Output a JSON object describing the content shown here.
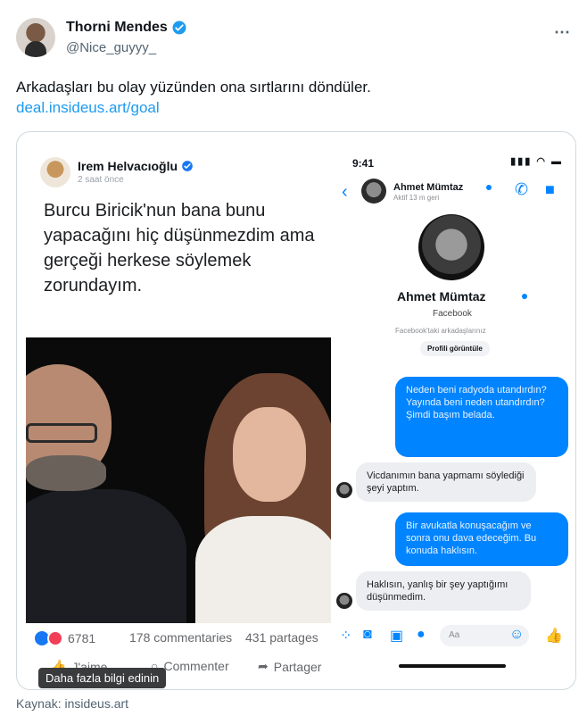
{
  "tweet": {
    "display_name": "Thorni Mendes",
    "handle": "@Nice_guyyy_",
    "more_icon": "⋯",
    "text": "Arkadaşları bu olay yüzünden ona sırtlarını döndüler.",
    "link": "deal.insideus.art/goal"
  },
  "fb_post": {
    "author": "Irem Helvacıoğlu",
    "time": "2 saat önce",
    "quote": "Burcu Biricik'nun bana bunu yapacağını hiç düşünmezdim ama gerçeği herkese söylemek zorundayım.",
    "reaction_count": "6781",
    "comments": "178 commentaries",
    "shares": "431 partages",
    "actions": {
      "like": "J'aime",
      "comment": "Commenter",
      "share": "Partager"
    },
    "tooltip": "Daha fazla bilgi edinin"
  },
  "messenger": {
    "time": "9:41",
    "status_icons": "▮▮▮ ◠ ▬",
    "contact": "Ahmet Mümtaz",
    "active": "Aktif 13 m geri",
    "network": "Facebook",
    "friends_note": "Facebook'taki arkadaşlarınız",
    "profile_button": "Profili görüntüle",
    "messages": [
      {
        "dir": "out",
        "text": "Neden beni radyoda utandırdın? Yayında beni neden utandırdın? Şimdi başım belada."
      },
      {
        "dir": "in",
        "text": "Vicdanımın bana yapmamı söylediği şeyi yaptım."
      },
      {
        "dir": "out",
        "text": "Bir avukatla konuşacağım ve sonra onu dava edeceğim. Bu konuda haklısın."
      },
      {
        "dir": "in",
        "text": "Haklısın, yanlış bir şey yaptığımı düşünmedim."
      }
    ],
    "input_placeholder": "Aa"
  },
  "source": "Kaynak: insideus.art",
  "colors": {
    "accent": "#1d9bf0",
    "messenger_blue": "#0084ff"
  }
}
